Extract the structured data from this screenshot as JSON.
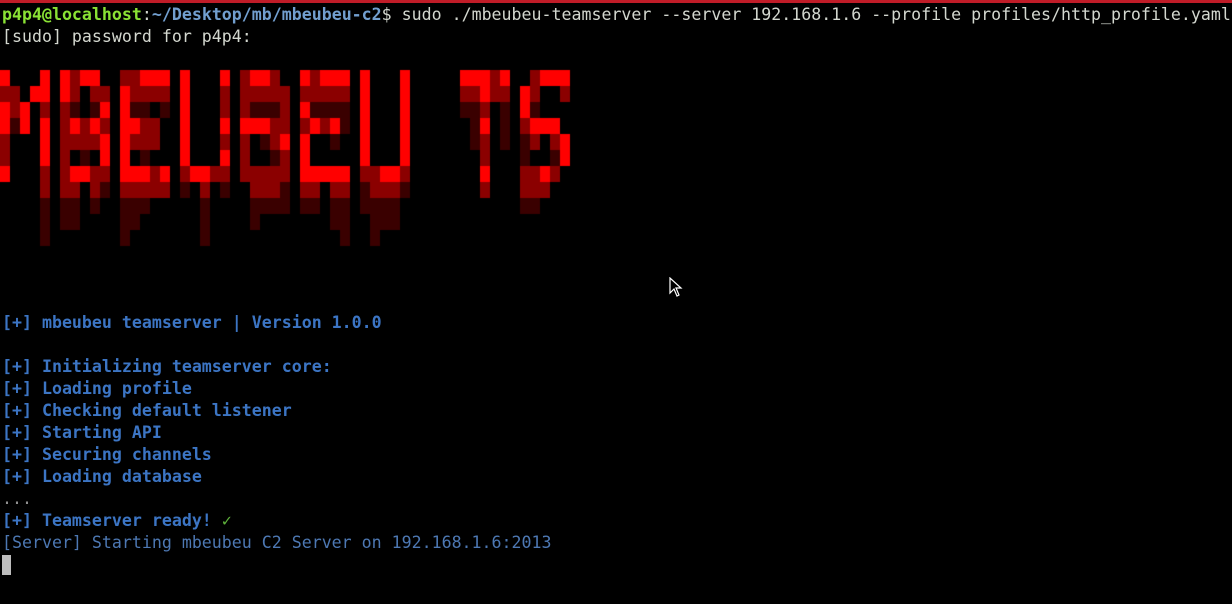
{
  "terminal": {
    "prompt": {
      "user_host": "p4p4@localhost",
      "separator": ":",
      "path": "~/Desktop/mb/mbeubeu-c2",
      "symbol": "$",
      "command": " sudo ./mbeubeu-teamserver --server 192.168.1.6 --profile profiles/http_profile.yaml"
    },
    "sudo_prompt": "[sudo] password for p4p4:",
    "banner": {
      "text": "MBEUBEU TS",
      "color": "#ff0000",
      "shadow_color": "#8b0000"
    },
    "version_line": "[+] mbeubeu teamserver | Version 1.0.0",
    "steps": [
      "[+] Initializing teamserver core:",
      "[+] Loading profile",
      "[+] Checking default listener",
      "[+] Starting API",
      "[+] Securing channels",
      "[+] Loading database"
    ],
    "ellipsis": "...",
    "ready_line": "[+] Teamserver ready!",
    "ready_check": "✓",
    "server_line": "[Server] Starting mbeubeu C2 Server on 192.168.1.6:2013"
  },
  "colors": {
    "background": "#000000",
    "prompt_user": "#8ae234",
    "prompt_path": "#729fcf",
    "info": "#3c75c4",
    "check": "#5fb33c",
    "server": "#4d78b3"
  }
}
